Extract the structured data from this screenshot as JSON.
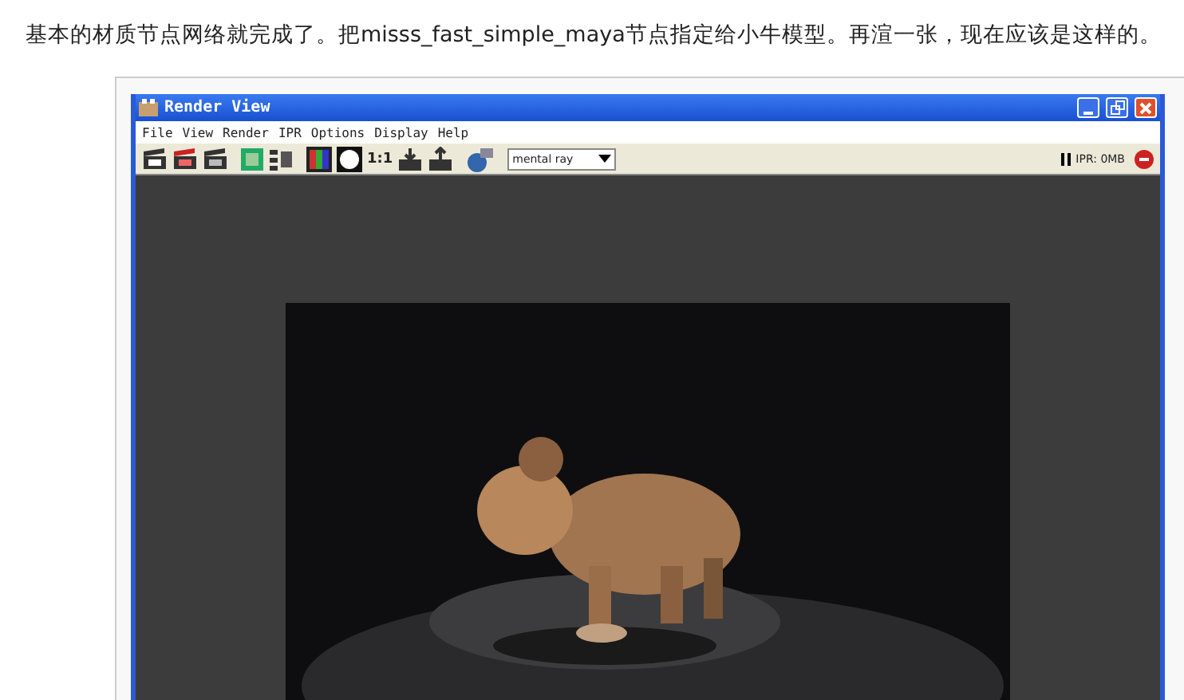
{
  "paragraph": "基本的材质节点网络就完成了。把misss_fast_simple_maya节点指定给小牛模型。再渲一张，现在应该是这样的。",
  "window": {
    "title": "Render View"
  },
  "menu": [
    "File",
    "View",
    "Render",
    "IPR",
    "Options",
    "Display",
    "Help"
  ],
  "toolbar": {
    "zoom_label": "1:1",
    "renderer": "mental ray",
    "ipr_status": "IPR: 0MB"
  }
}
